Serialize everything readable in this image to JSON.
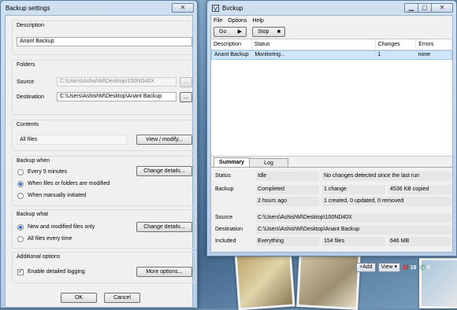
{
  "colors": {
    "accent": "#2a6bc9",
    "selection": "#cfe6fb",
    "gmail_red": "#d93025",
    "voice_green": "#3aa757"
  },
  "settings_dialog": {
    "title": "Backup settings",
    "description": {
      "label": "Description",
      "value": "Anant Backup"
    },
    "folders": {
      "label": "Folders",
      "source_label": "Source",
      "source_value": "C:\\Users\\AshishM\\Desktop\\100ND40X",
      "destination_label": "Destination",
      "destination_value": "C:\\Users\\AshishM\\Desktop\\Anant Backup",
      "browse_label": "..."
    },
    "contents": {
      "label": "Contents",
      "value": "All files",
      "view_modify": "View / modify..."
    },
    "backup_when": {
      "label": "Backup when",
      "options": [
        "Every 5 minutes",
        "When files or folders are modified",
        "When manually initiated"
      ],
      "selected_index": 1,
      "change_details": "Change details..."
    },
    "backup_what": {
      "label": "Backup what",
      "options": [
        "New and modified files only",
        "All files every time"
      ],
      "selected_index": 0,
      "change_details": "Change details..."
    },
    "additional": {
      "label": "Additional options",
      "detailed_logging": "Enable detailed logging",
      "detailed_logging_checked": true,
      "more_options": "More options..."
    },
    "ok": "OK",
    "cancel": "Cancel",
    "close_glyph": "✕"
  },
  "main_window": {
    "title": "Bvckup",
    "window_controls": {
      "minimize": "▁",
      "maximize": "▢",
      "close": "✕"
    },
    "menu": [
      "File",
      "Options",
      "Help"
    ],
    "toolbar": {
      "go": "Go",
      "stop": "Stop"
    },
    "columns": [
      "Description",
      "Status",
      "Changes",
      "Errors"
    ],
    "rows": [
      {
        "description": "Anant Backup",
        "status": "Monitoring...",
        "changes": "1",
        "errors": "none"
      }
    ],
    "tabs": [
      "Summary",
      "Log"
    ],
    "active_tab": 0,
    "summary": {
      "status_label": "Status",
      "status_value": "Idle",
      "status_note": "No changes detected since the last run",
      "backup_label": "Backup",
      "backup_completed": "Completed",
      "backup_changes": "1  change",
      "backup_copied": "4536 KB copied",
      "backup_time": "2 hours ago",
      "backup_detail": "1 created, 0 updated, 0 removed",
      "source_label": "Source",
      "source_value": "C:\\Users\\AshishM\\Desktop\\100ND40X",
      "destination_label": "Destination",
      "destination_value": "C:\\Users\\AshishM\\Desktop\\Anant Backup",
      "included_label": "Included",
      "included_value": "Everything",
      "included_files": "154 files",
      "included_size": "646 MB"
    }
  },
  "gadget": {
    "add": "+Add",
    "view": "View ▾",
    "mail_count": "18",
    "calls_count": "0"
  }
}
